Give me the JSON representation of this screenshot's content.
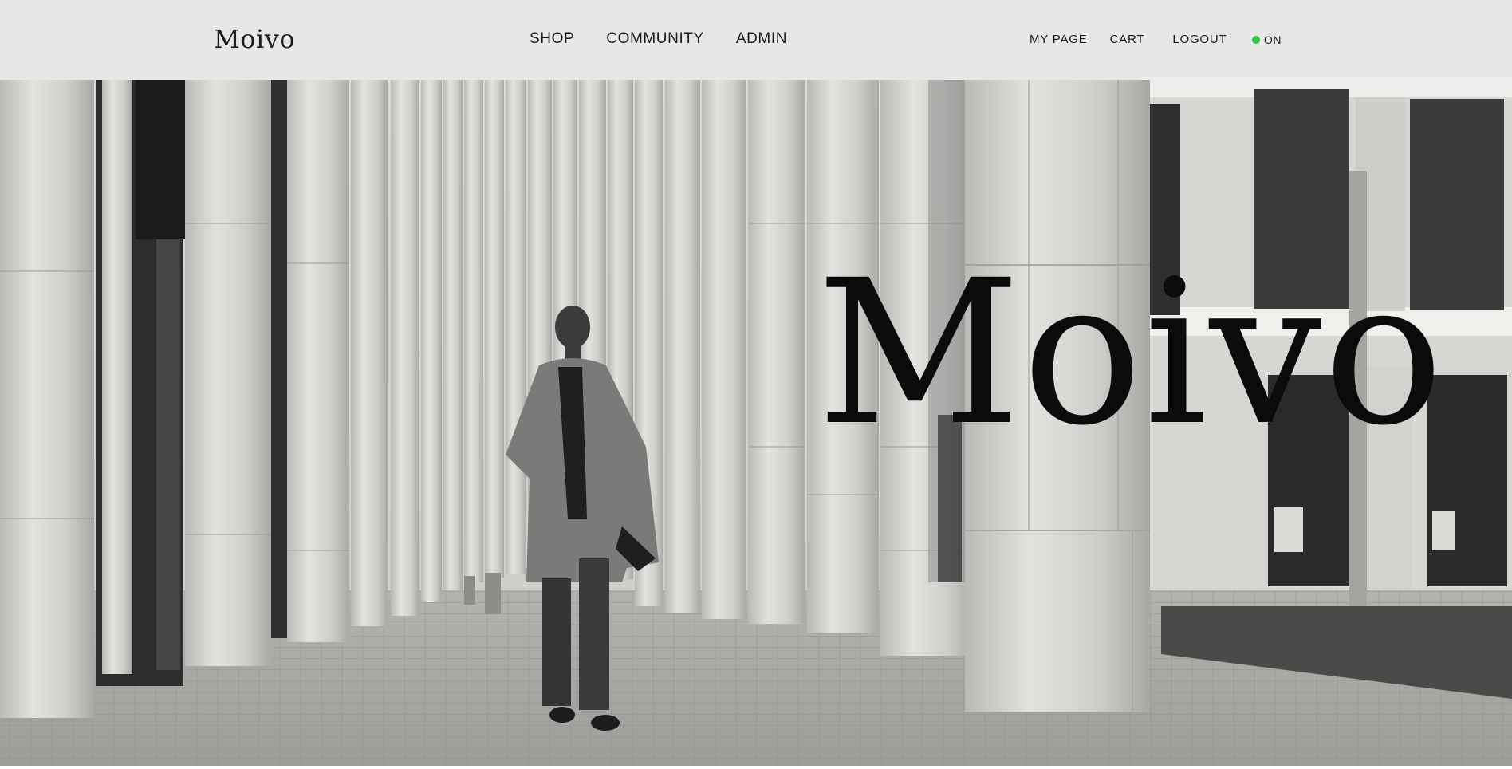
{
  "header": {
    "logo": "Moivo",
    "nav_main": [
      "SHOP",
      "COMMUNITY",
      "ADMIN"
    ],
    "nav_user": {
      "my_page": "MY PAGE",
      "cart": "CART",
      "logout": "LOGOUT"
    },
    "status": {
      "label": "ON",
      "color": "#35c24a"
    }
  },
  "hero": {
    "title": "Moivo",
    "image": "black-and-white street scene: man in overcoat walking past a colonnade of stone pillars"
  }
}
